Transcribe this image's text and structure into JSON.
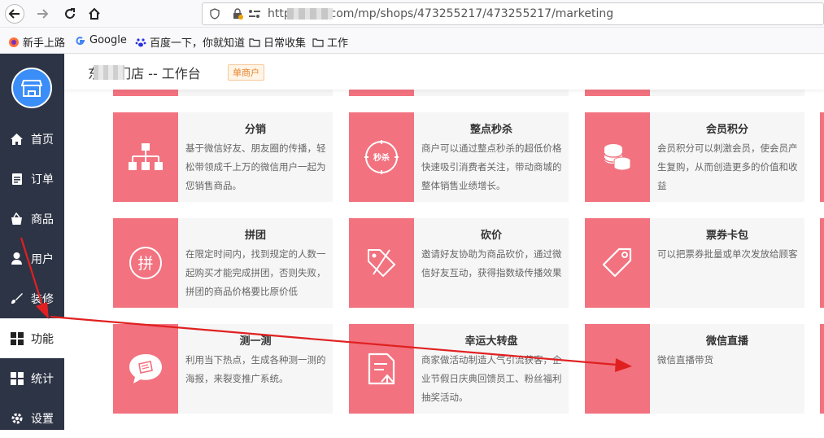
{
  "browser": {
    "url": "https://a          n.com/mp/shops/473255217/473255217/marketing",
    "bookmarks": [
      "新手上路",
      "Google",
      "百度一下，你就知道",
      "日常收集",
      "工作"
    ]
  },
  "header": {
    "title": "东    能门店 -- 工作台",
    "badge": "单商户"
  },
  "sidebar": {
    "items": [
      {
        "label": "首页",
        "icon": "home-icon"
      },
      {
        "label": "订单",
        "icon": "order-icon"
      },
      {
        "label": "商品",
        "icon": "bag-icon"
      },
      {
        "label": "用户",
        "icon": "user-icon"
      },
      {
        "label": "装修",
        "icon": "brush-icon"
      },
      {
        "label": "功能",
        "icon": "grid-icon"
      },
      {
        "label": "统计",
        "icon": "grid-icon"
      },
      {
        "label": "设置",
        "icon": "gear-icon"
      }
    ],
    "active_index": 5
  },
  "cards": [
    {
      "title": "分销",
      "desc": "基于微信好友、朋友圈的传播，轻松带领成千上万的微信用户一起为您销售商品。",
      "icon": "tree-icon"
    },
    {
      "title": "整点秒杀",
      "desc": "商户可以通过整点秒杀的超低价格快速吸引消费者关注，带动商城的整体销售业绩增长。",
      "icon": "seckill-icon"
    },
    {
      "title": "会员积分",
      "desc": "会员积分可以刺激会员，使会员产生复购，从而创造更多的价值和收益",
      "icon": "coins-icon"
    },
    {
      "title": "拼团",
      "desc": "在限定时间内，找到规定的人数一起购买才能完成拼团，否则失败，拼团的商品价格要比原价低",
      "icon": "pin-icon"
    },
    {
      "title": "砍价",
      "desc": "邀请好友协助为商品砍价，通过微信好友互动，获得指数级传播效果",
      "icon": "cut-tag-icon"
    },
    {
      "title": "票券卡包",
      "desc": "可以把票券批量或单次发放给顾客",
      "icon": "ticket-icon"
    },
    {
      "title": "测一测",
      "desc": "利用当下热点，生成各种测一测的海报，来裂变推广系统。",
      "icon": "chat-icon"
    },
    {
      "title": "幸运大转盘",
      "desc": "商家做活动制造人气引流获客，企业节假日庆典回馈员工、粉丝福利抽奖活动。",
      "icon": "document-icon"
    },
    {
      "title": "微信直播",
      "desc": "微信直播带货",
      "icon": ""
    }
  ],
  "colors": {
    "sidebar": "#2d3446",
    "accent": "#f2727f",
    "badge": "#e8832a",
    "annotation": "#e02020"
  }
}
